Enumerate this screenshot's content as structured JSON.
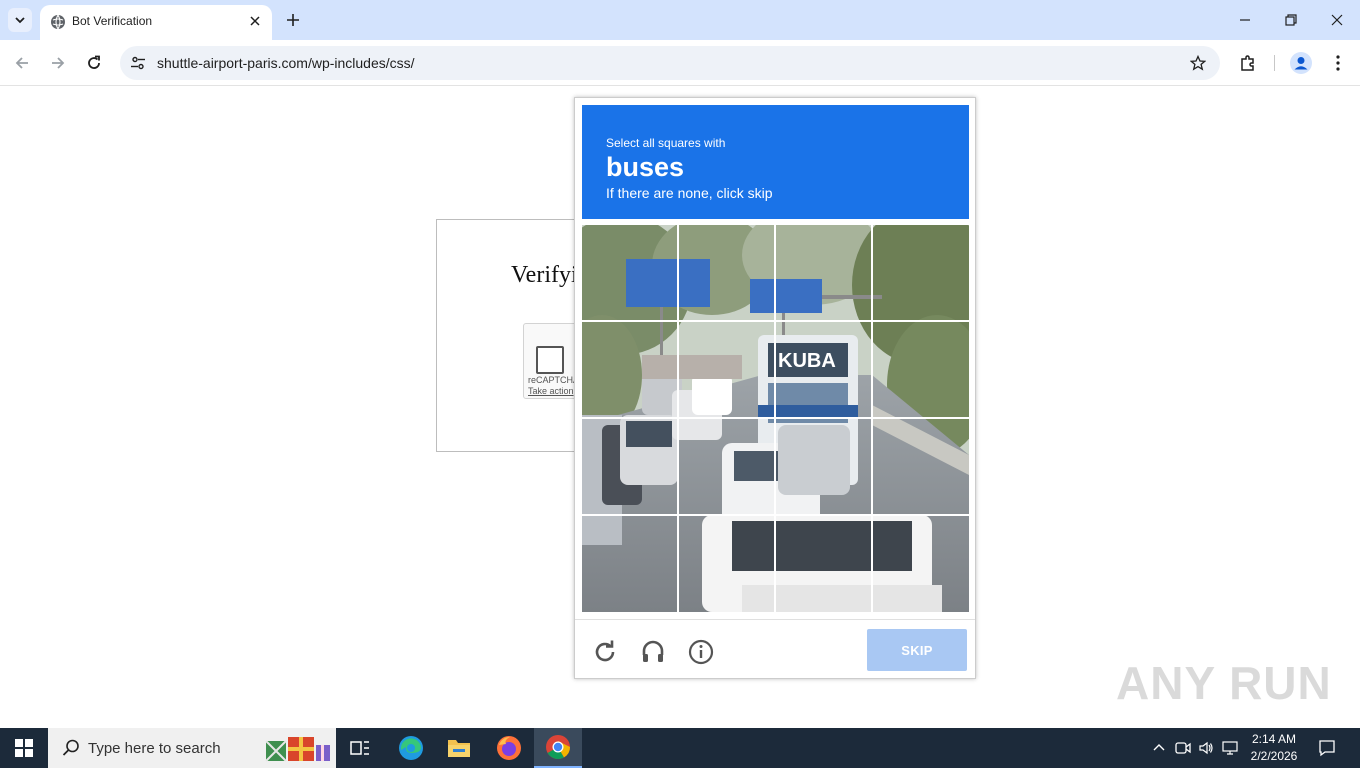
{
  "browser": {
    "tab": {
      "title": "Bot Verification"
    },
    "address_bar": {
      "url": "shuttle-airport-paris.com/wp-includes/css/"
    }
  },
  "page": {
    "heading": "Verifyi",
    "recaptcha": {
      "brand": "reCAPTCHA",
      "link": "Take action"
    }
  },
  "challenge": {
    "instruction": "Select all squares with",
    "target": "buses",
    "hint": "If there are none, click skip",
    "skip_label": "SKIP",
    "footer_icons": [
      "reload-icon",
      "audio-icon",
      "info-icon"
    ],
    "grid": {
      "rows": 4,
      "cols": 4
    },
    "accent_color": "#1a73e8"
  },
  "watermark": "ANY RUN",
  "taskbar": {
    "search_placeholder": "Type here to search",
    "apps": [
      "task-view-icon",
      "edge-icon",
      "file-explorer-icon",
      "firefox-icon",
      "chrome-icon"
    ],
    "clock": {
      "time": "2:14 AM",
      "date": "2/2/2026"
    }
  }
}
